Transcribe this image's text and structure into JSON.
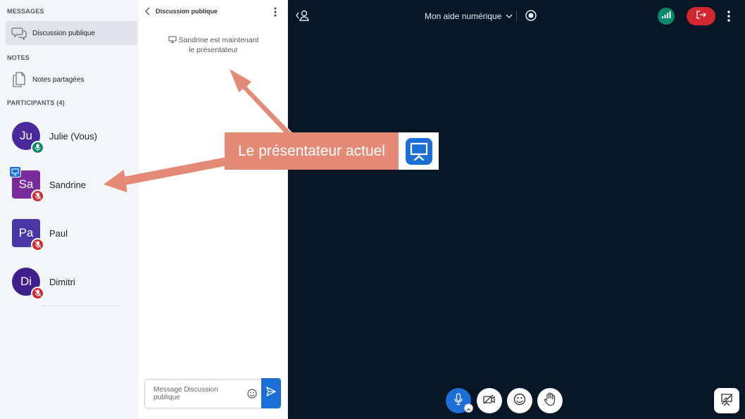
{
  "sidebar": {
    "messages_title": "MESSAGES",
    "public_chat_label": "Discussion publique",
    "notes_title": "NOTES",
    "shared_notes_label": "Notes partagées",
    "participants_title": "PARTICIPANTS (4)",
    "participants": [
      {
        "initials": "Ju",
        "name": "Julie (Vous)",
        "color": "#4a2a9a",
        "shape": "circle",
        "audio": "unmuted",
        "presenter": false
      },
      {
        "initials": "Sa",
        "name": "Sandrine",
        "color": "#7b2c9c",
        "shape": "square",
        "audio": "muted",
        "presenter": true
      },
      {
        "initials": "Pa",
        "name": "Paul",
        "color": "#4b36a8",
        "shape": "square",
        "audio": "muted",
        "presenter": false
      },
      {
        "initials": "Di",
        "name": "Dimitri",
        "color": "#3f1f8c",
        "shape": "circle",
        "audio": "muted",
        "presenter": false
      }
    ]
  },
  "chat": {
    "title": "Discussion publique",
    "system_message_line1": "Sandrine est maintenant",
    "system_message_line2": "le présentateur",
    "input_placeholder": "Message Discussion publique"
  },
  "main": {
    "session_title": "Mon aide numérique",
    "colors": {
      "background": "#061627",
      "accent": "#1b6fd6",
      "leave": "#d3272f",
      "connection": "#0a8a6a"
    }
  },
  "annotation": {
    "callout_text": "Le présentateur actuel",
    "callout_color": "#e48a77"
  }
}
